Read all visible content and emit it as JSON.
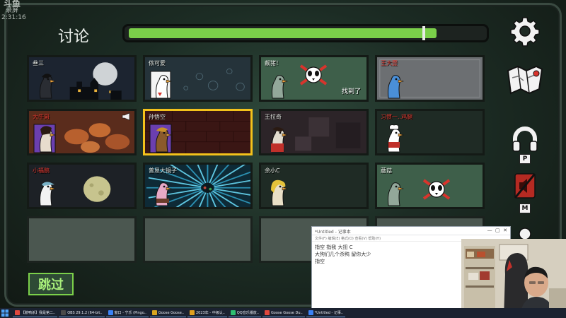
{
  "watermark": {
    "line1": "斗鱼",
    "line2": "录屏",
    "line3": "2:31:16"
  },
  "header": {
    "title": "讨论",
    "timer_fraction": 0.85
  },
  "players": [
    {
      "name": "叁三",
      "name_color": "white",
      "state": "alive",
      "bg": "night-town",
      "avatar": "crow",
      "selected": false
    },
    {
      "name": "侬可爱",
      "name_color": "white",
      "state": "alive",
      "bg": "dark-bubbles",
      "avatar": "duck-card",
      "selected": false
    },
    {
      "name": "靓猪！",
      "name_color": "white",
      "state": "dead",
      "bg": "green",
      "avatar": "duck-faded",
      "selected": false,
      "note": "找到了"
    },
    {
      "name": "王大壹",
      "name_color": "red",
      "state": "alive",
      "bg": "grey",
      "avatar": "blue-goose",
      "selected": false
    },
    {
      "name": "大牛哥",
      "name_color": "red",
      "state": "alive",
      "bg": "turkeys",
      "avatar": "purple-frame-goose",
      "selected": false,
      "megaphone": true
    },
    {
      "name": "孙悟空",
      "name_color": "white",
      "state": "alive",
      "bg": "red-brick",
      "avatar": "monkey-goose",
      "selected": true
    },
    {
      "name": "王拉奇",
      "name_color": "white",
      "state": "alive",
      "bg": "dark-blocks",
      "avatar": "red-goose",
      "selected": false
    },
    {
      "name": "习惯一..鸡腿",
      "name_color": "red",
      "state": "alive",
      "bg": "dark-green",
      "avatar": "chef-goose",
      "selected": false
    },
    {
      "name": "小福鹅",
      "name_color": "red",
      "state": "alive",
      "bg": "moon",
      "avatar": "cap-goose",
      "selected": false
    },
    {
      "name": "普思大镜子",
      "name_color": "white",
      "state": "alive",
      "bg": "warp",
      "avatar": "pink-goose",
      "selected": false
    },
    {
      "name": "余小C",
      "name_color": "white",
      "state": "alive",
      "bg": "dark-green",
      "avatar": "blonde-goose",
      "selected": false
    },
    {
      "name": "蘑菇",
      "name_color": "white",
      "state": "dead",
      "bg": "green",
      "avatar": "duck-faded",
      "selected": false
    }
  ],
  "skip": {
    "label": "跳过"
  },
  "sidebar": {
    "push_to_talk_key": "P",
    "mute_key": "M"
  },
  "notepad": {
    "title": "*Untitled - 记事本",
    "menu": "文件(F) 编辑(E) 格式(O) 查看(V) 帮助(H)",
    "lines": [
      "指空 指我 大扭 C",
      "大狗们几个杀鸭 留你大少",
      "指空"
    ]
  },
  "taskbar": [
    {
      "label": "【鹅鸭杀】我是第二..",
      "color": "#e0483e"
    },
    {
      "label": "OBS 29.1.2 (64-bit..",
      "color": "#4a4a4a"
    },
    {
      "label": "窗口 - 宁乐 (Pingo..",
      "color": "#3b82f6"
    },
    {
      "label": "Goose Goose..",
      "color": "#d9a51f"
    },
    {
      "label": "2023年 - 中级认..",
      "color": "#e0a01f"
    },
    {
      "label": "QQ音乐播放..",
      "color": "#2fbf71"
    },
    {
      "label": "Goose Goose Du..",
      "color": "#e0483e"
    },
    {
      "label": "*Untitled - 记事..",
      "color": "#3b82f6"
    }
  ],
  "colors": {
    "timer": "#7bd04a",
    "selected": "#f4c21b",
    "dead_x": "#d8342c",
    "skip": "#7bd04a"
  }
}
